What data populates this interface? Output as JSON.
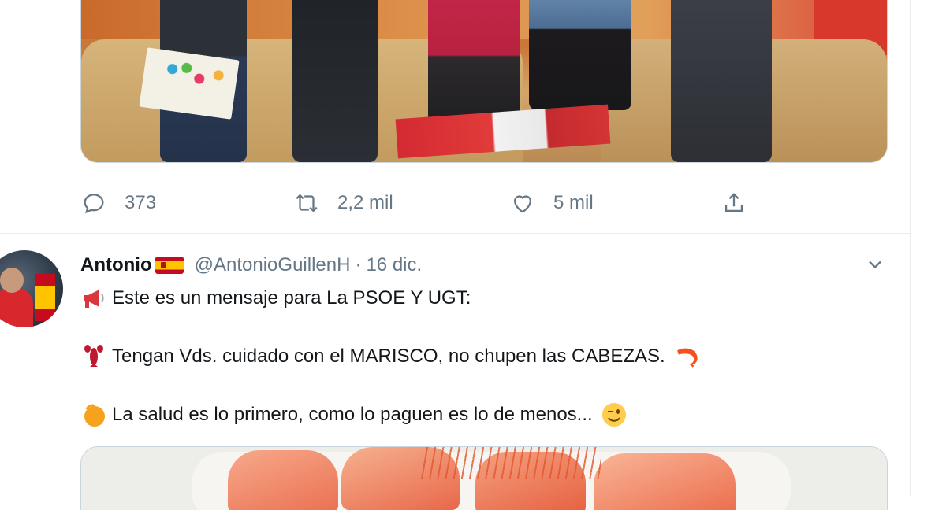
{
  "tweet1": {
    "image_alt": "",
    "actions": {
      "reply_count": "373",
      "retweet_count": "2,2 mil",
      "like_count": "5 mil"
    }
  },
  "tweet2": {
    "display_name": "Antonio",
    "handle": "@AntonioGuillenH",
    "separator": "·",
    "time": "16 dic.",
    "lines": [
      "Este es un mensaje para La PSOE Y UGT:",
      "Tengan Vds. cuidado con el MARISCO, no chupen las CABEZAS.",
      "La salud es lo primero, como lo paguen es lo de menos..."
    ]
  },
  "colors": {
    "text_primary": "#14171a",
    "text_secondary": "#657786",
    "border": "#e6ecf0"
  },
  "icons": {
    "reply": "speech-bubble-icon",
    "retweet": "retweet-arrows-icon",
    "like": "heart-icon",
    "share": "share-upload-icon",
    "caret": "chevron-down-icon",
    "flag": "spain-flag-emoji",
    "megaphone": "megaphone-emoji",
    "lobster": "lobster-emoji",
    "shrimp": "shrimp-emoji",
    "orange_circle": "orange-circle-emoji",
    "wink": "winking-face-emoji"
  }
}
